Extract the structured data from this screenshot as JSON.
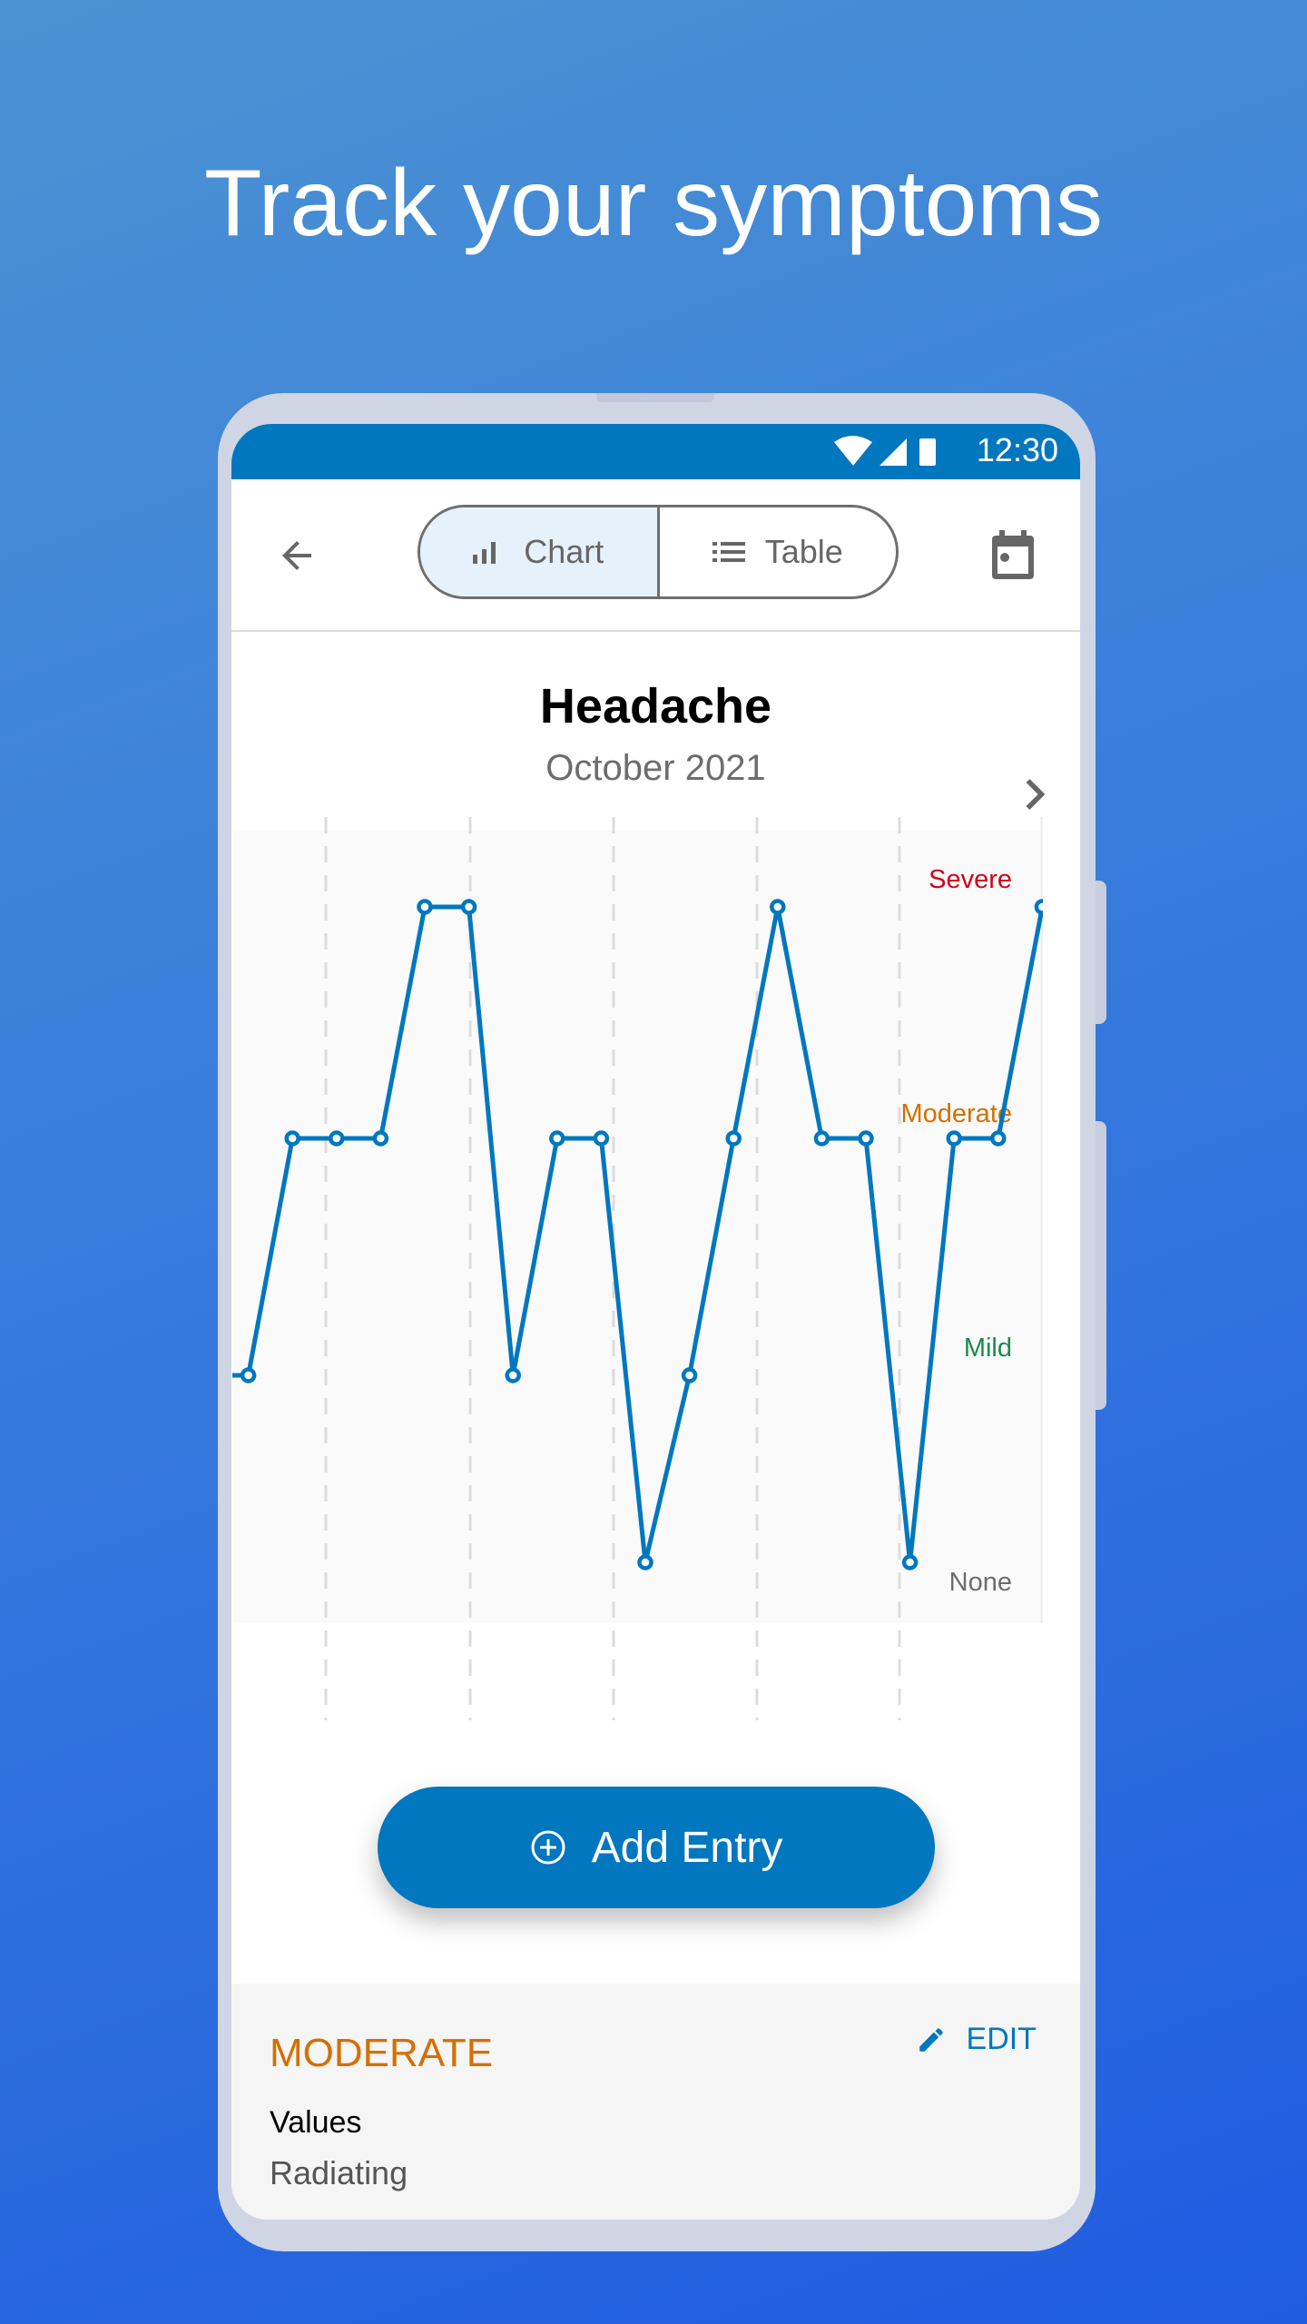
{
  "headline": "Track your symptoms",
  "status_bar": {
    "time": "12:30",
    "icons": [
      "wifi-icon",
      "signal-icon",
      "battery-icon"
    ]
  },
  "toolbar": {
    "back_icon": "arrow-left-icon",
    "tabs": [
      {
        "label": "Chart",
        "icon": "bar-chart-icon",
        "selected": true
      },
      {
        "label": "Table",
        "icon": "list-icon",
        "selected": false
      }
    ],
    "calendar_icon": "calendar-icon"
  },
  "chart_header": {
    "title": "Headache",
    "subtitle": "October 2021",
    "next_icon": "chevron-right-icon"
  },
  "chart_data": {
    "type": "line",
    "title": "Headache",
    "subtitle": "October 2021",
    "y_levels": [
      "None",
      "Mild",
      "Moderate",
      "Severe"
    ],
    "y_level_colors": [
      "#6d6d6d",
      "#1a8a4a",
      "#d46f00",
      "#d0021b"
    ],
    "values": [
      1,
      1,
      2,
      2,
      2,
      3,
      3,
      1,
      2,
      2,
      0,
      1,
      2,
      3,
      2,
      2,
      0,
      2,
      2,
      3
    ],
    "series_color": "#0077be",
    "grid": "vertical dashed"
  },
  "add_button": {
    "label": "Add Entry",
    "icon": "plus-circle-icon"
  },
  "detail": {
    "severity": "MODERATE",
    "edit_label": "EDIT",
    "values_label": "Values",
    "values_value": "Radiating"
  },
  "colors": {
    "accent": "#0077be",
    "moderate": "#d46f00"
  }
}
